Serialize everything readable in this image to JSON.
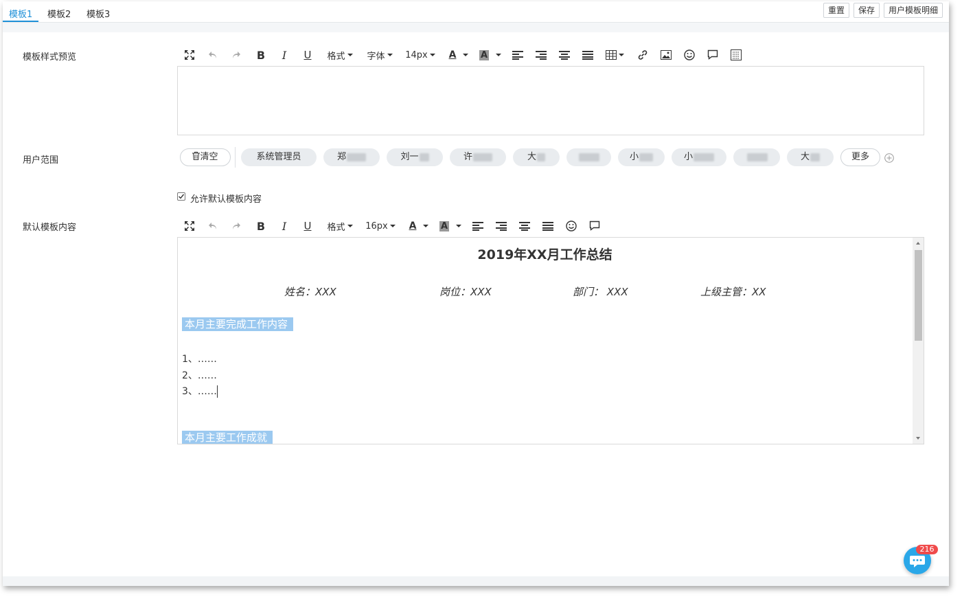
{
  "tabs": [
    {
      "label": "模板1",
      "active": true
    },
    {
      "label": "模板2",
      "active": false
    },
    {
      "label": "模板3",
      "active": false
    }
  ],
  "top_buttons": {
    "reset": "重置",
    "save": "保存",
    "detail": "用户模板明细"
  },
  "preview": {
    "label": "模板样式预览",
    "format": "格式",
    "font": "字体",
    "size": "14px"
  },
  "user_range": {
    "label": "用户范围",
    "clear": "清空",
    "chips": [
      "系统管理员",
      "郑",
      "刘一",
      "许",
      "大",
      "",
      "小",
      "小",
      "",
      "大"
    ],
    "more": "更多"
  },
  "allow_default": {
    "label": "允许默认模板内容",
    "checked": true
  },
  "default_content": {
    "label": "默认模板内容",
    "format": "格式",
    "size": "16px",
    "doc": {
      "title": "2019年XX月工作总结",
      "name": "姓名：XXX",
      "position": "岗位：XXX",
      "dept": "部门： XXX",
      "supervisor": "上级主管：XX",
      "section1": "本月主要完成工作内容",
      "items": [
        "1、……",
        "2、……",
        "3、……"
      ],
      "section2": "本月主要工作成就"
    }
  },
  "chat": {
    "badge": "216"
  },
  "colors": {
    "accent": "#1e90d8",
    "highlight": "#9bc9f0",
    "badge": "#f04b4b",
    "chat": "#2aa7e8"
  }
}
